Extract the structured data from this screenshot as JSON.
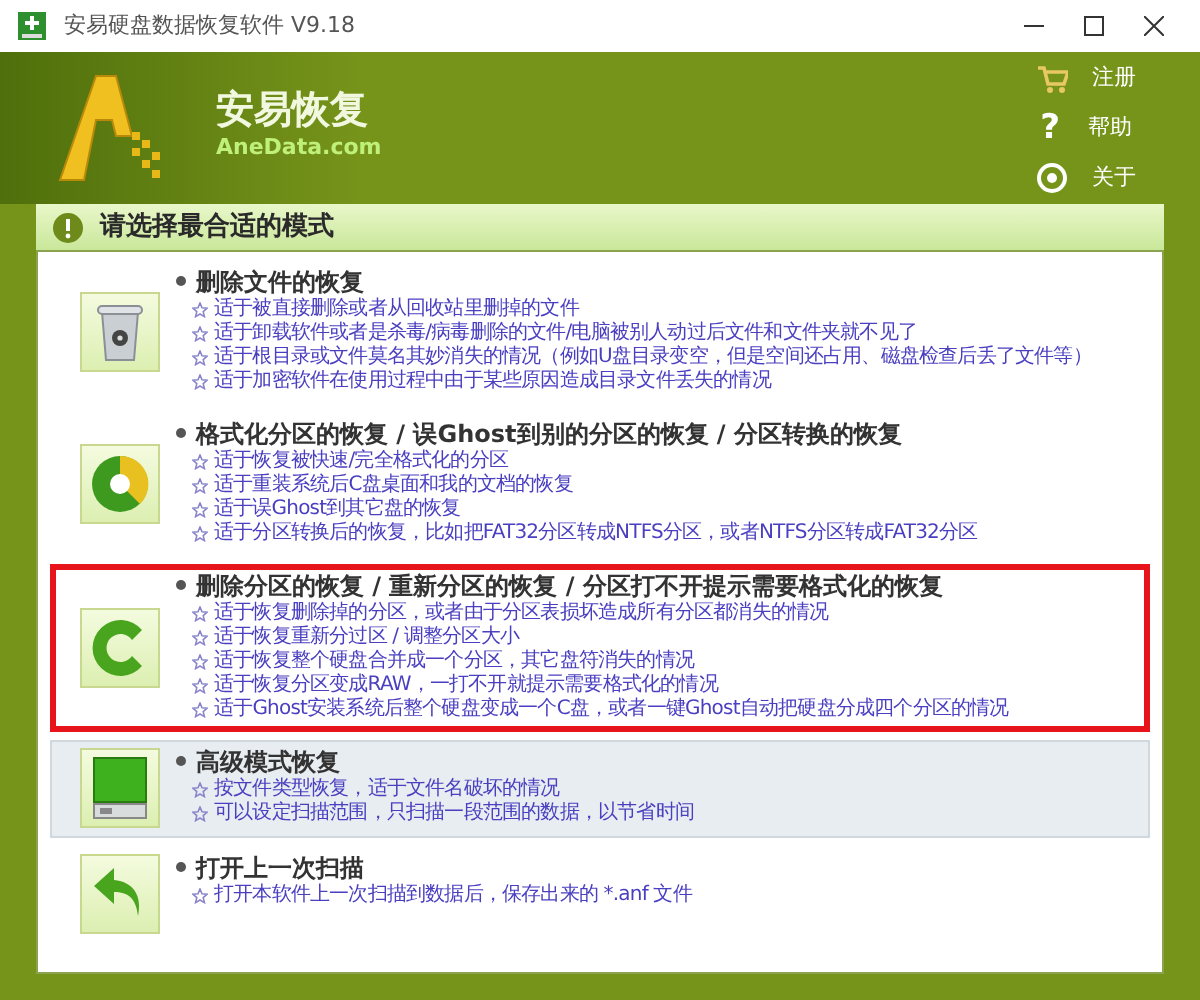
{
  "window": {
    "title": "安易硬盘数据恢复软件 V9.18"
  },
  "header": {
    "brand": "安易恢复",
    "site": "AneData.com",
    "menu": [
      {
        "kind": "cart",
        "label": "注册"
      },
      {
        "kind": "help",
        "icon_text": "?",
        "label": "帮助"
      },
      {
        "kind": "about",
        "label": "关于"
      }
    ]
  },
  "banner": {
    "text": "请选择最合适的模式"
  },
  "options": [
    {
      "kind": "trash",
      "title": "删除文件的恢复",
      "highlighted": false,
      "hovered": false,
      "lines": [
        "适于被直接删除或者从回收站里删掉的文件",
        "适于卸载软件或者是杀毒/病毒删除的文件/电脑被别人动过后文件和文件夹就不见了",
        "适于根目录或文件莫名其妙消失的情况（例如U盘目录变空，但是空间还占用、磁盘检查后丢了文件等）",
        "适于加密软件在使用过程中由于某些原因造成目录文件丢失的情况"
      ]
    },
    {
      "kind": "pie",
      "title": "格式化分区的恢复 / 误Ghost到别的分区的恢复 / 分区转换的恢复",
      "highlighted": false,
      "hovered": false,
      "lines": [
        "适于恢复被快速/完全格式化的分区",
        "适于重装系统后C盘桌面和我的文档的恢复",
        "适于误Ghost到其它盘的恢复",
        "适于分区转换后的恢复，比如把FAT32分区转成NTFS分区，或者NTFS分区转成FAT32分区"
      ]
    },
    {
      "kind": "ring",
      "title": "删除分区的恢复 / 重新分区的恢复 / 分区打不开提示需要格式化的恢复",
      "highlighted": true,
      "hovered": false,
      "lines": [
        "适于恢复删除掉的分区，或者由于分区表损坏造成所有分区都消失的情况",
        "适于恢复重新分过区 / 调整分区大小",
        "适于恢复整个硬盘合并成一个分区，其它盘符消失的情况",
        "适于恢复分区变成RAW，一打不开就提示需要格式化的情况",
        "适于Ghost安装系统后整个硬盘变成一个C盘，或者一键Ghost自动把硬盘分成四个分区的情况"
      ]
    },
    {
      "kind": "drive",
      "title": "高级模式恢复",
      "highlighted": false,
      "hovered": true,
      "lines": [
        "按文件类型恢复，适于文件名破坏的情况",
        "可以设定扫描范围，只扫描一段范围的数据，以节省时间"
      ]
    },
    {
      "kind": "back",
      "title": "打开上一次扫描",
      "highlighted": false,
      "hovered": false,
      "lines": [
        "打开本软件上一次扫描到数据后，保存出来的 *.anf 文件"
      ]
    }
  ]
}
